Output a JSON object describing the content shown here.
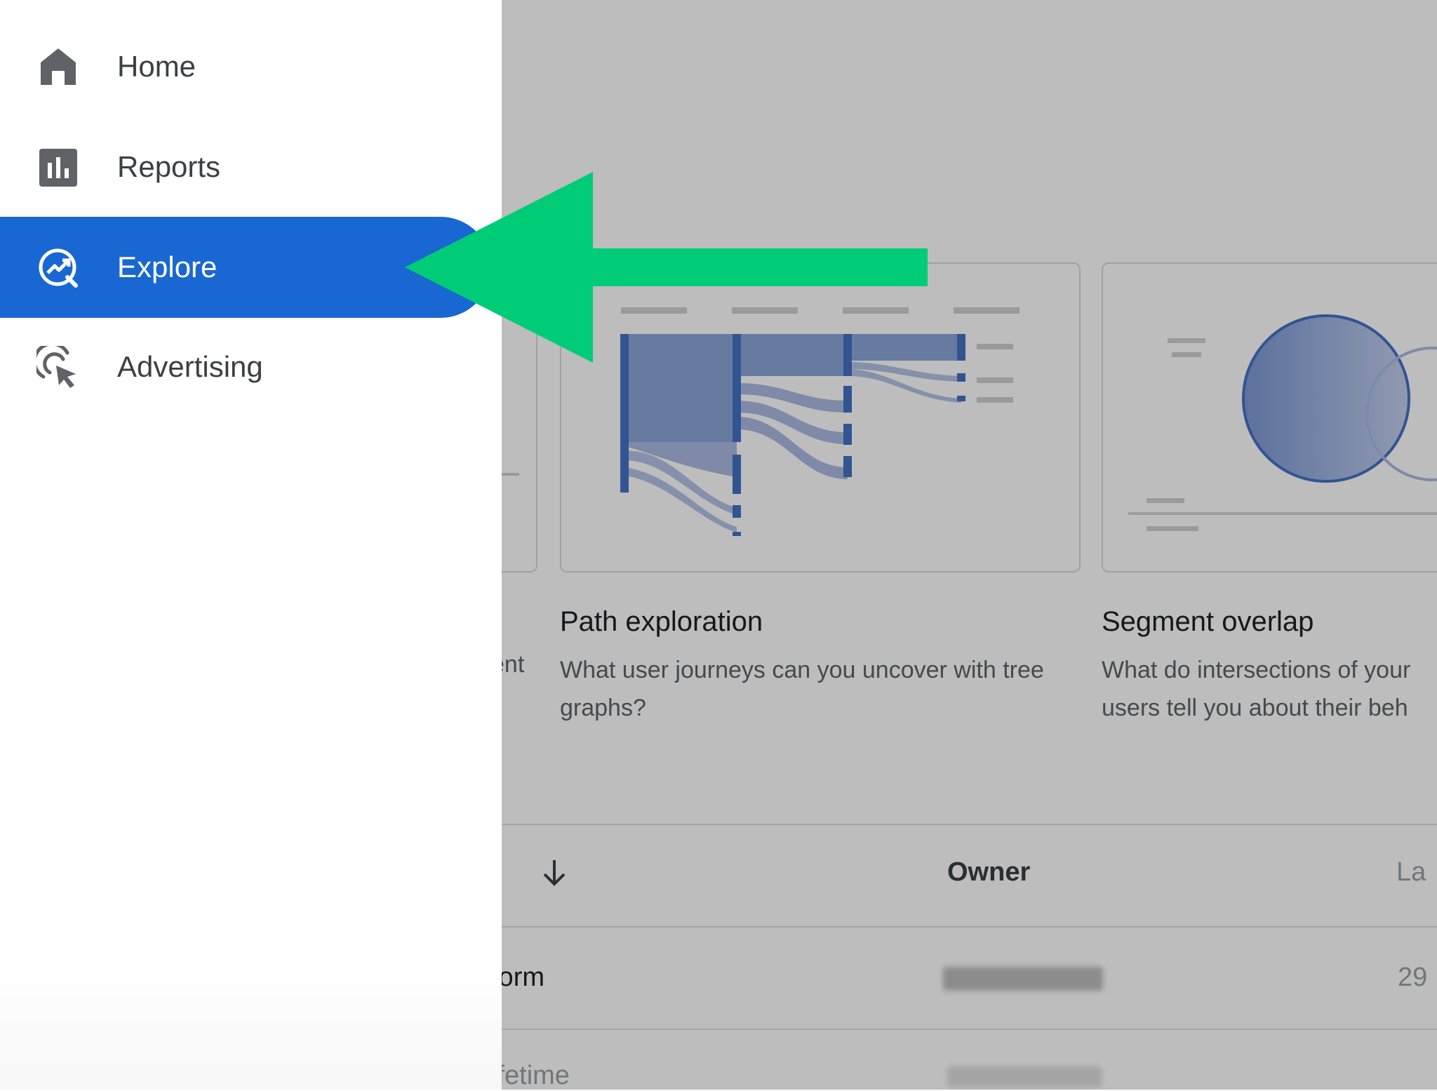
{
  "nav": {
    "items": [
      {
        "label": "Home",
        "icon": "home-icon"
      },
      {
        "label": "Reports",
        "icon": "bar-chart-icon"
      },
      {
        "label": "Explore",
        "icon": "explore-icon",
        "active": true
      },
      {
        "label": "Advertising",
        "icon": "advertising-target-icon"
      }
    ]
  },
  "templates": {
    "partial_desc": "ent",
    "path": {
      "title": "Path exploration",
      "description": "What user journeys can you uncover with tree graphs?"
    },
    "segment": {
      "title": "Segment overlap",
      "description_line1": "What do intersections of your",
      "description_line2": "users tell you about their beh"
    }
  },
  "table": {
    "headers": {
      "owner": "Owner",
      "last": "La"
    },
    "rows": [
      {
        "name": "form",
        "date": "29"
      },
      {
        "name": "ifetime"
      }
    ]
  },
  "colors": {
    "accent": "#1967d2",
    "annotation_arrow": "#00cc78",
    "chart_blue": "#4472c4"
  }
}
